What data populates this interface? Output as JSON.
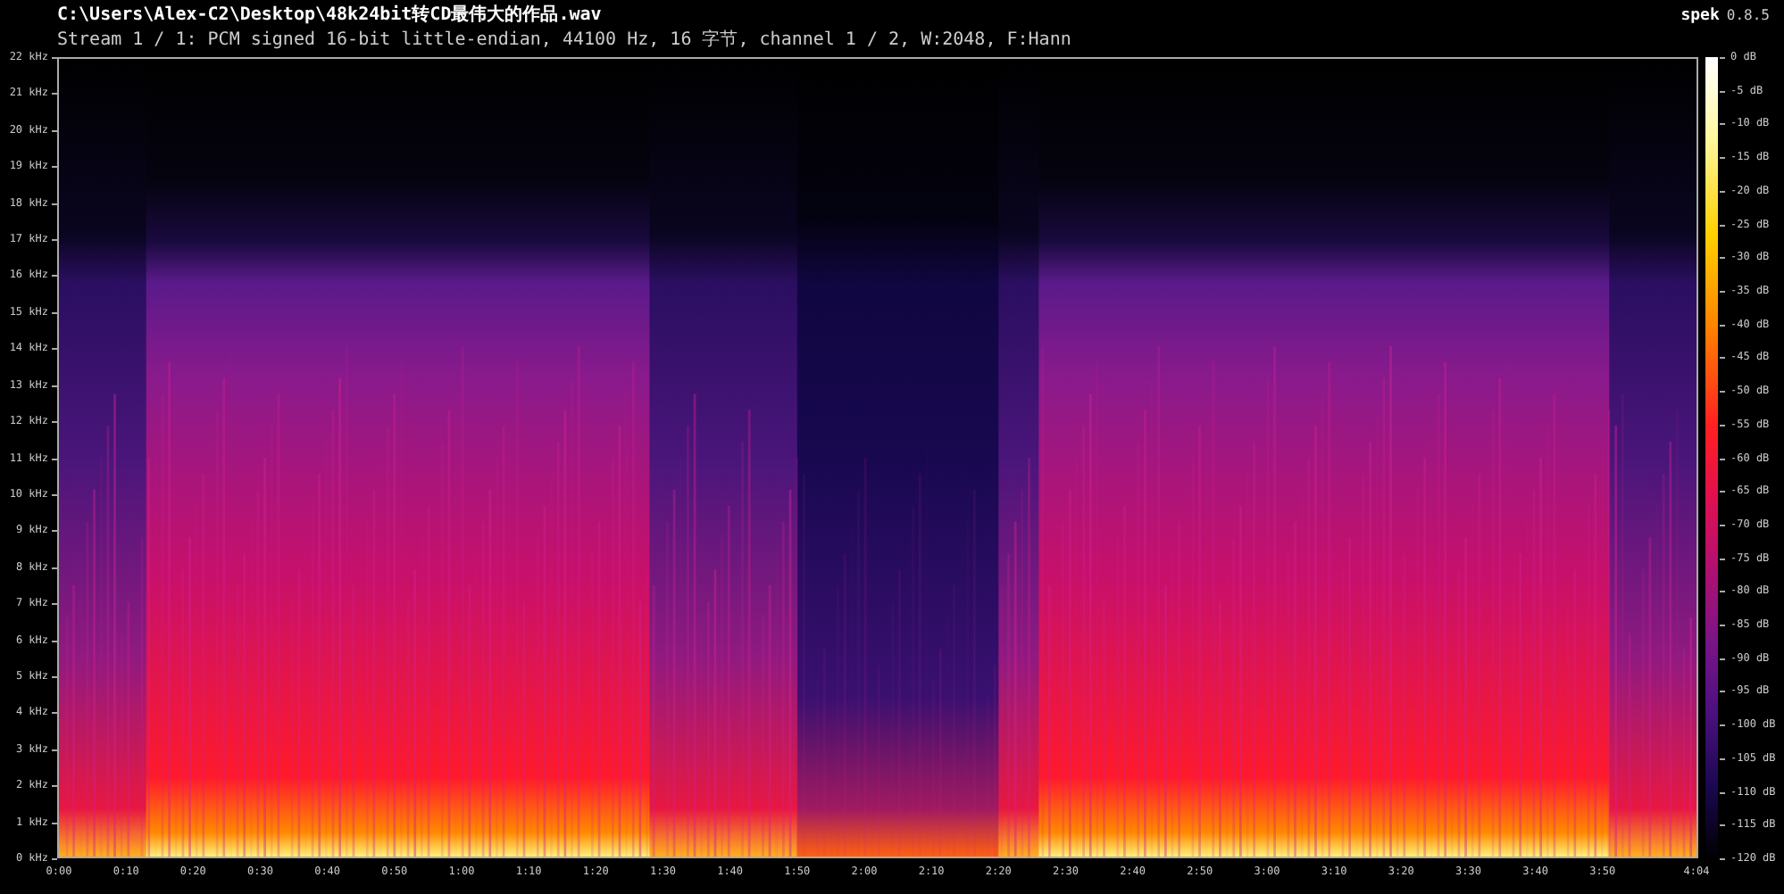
{
  "file_title": "C:\\Users\\Alex-C2\\Desktop\\48k24bit转CD最伟大的作品.wav",
  "stream_info": "Stream 1 / 1: PCM signed 16-bit little-endian, 44100 Hz, 16 字节, channel 1 / 2, W:2048, F:Hann",
  "app_name": "spek",
  "app_version": "0.8.5",
  "frequency_axis": [
    "22 kHz",
    "21 kHz",
    "20 kHz",
    "19 kHz",
    "18 kHz",
    "17 kHz",
    "16 kHz",
    "15 kHz",
    "14 kHz",
    "13 kHz",
    "12 kHz",
    "11 kHz",
    "10 kHz",
    "9 kHz",
    "8 kHz",
    "7 kHz",
    "6 kHz",
    "5 kHz",
    "4 kHz",
    "3 kHz",
    "2 kHz",
    "1 kHz",
    "0 kHz"
  ],
  "time_axis": [
    "0:00",
    "0:10",
    "0:20",
    "0:30",
    "0:40",
    "0:50",
    "1:00",
    "1:10",
    "1:20",
    "1:30",
    "1:40",
    "1:50",
    "2:00",
    "2:10",
    "2:20",
    "2:30",
    "2:40",
    "2:50",
    "3:00",
    "3:10",
    "3:20",
    "3:30",
    "3:40",
    "3:50",
    "4:04"
  ],
  "db_scale": [
    "0 dB",
    "-5 dB",
    "-10 dB",
    "-15 dB",
    "-20 dB",
    "-25 dB",
    "-30 dB",
    "-35 dB",
    "-40 dB",
    "-45 dB",
    "-50 dB",
    "-55 dB",
    "-60 dB",
    "-65 dB",
    "-70 dB",
    "-75 dB",
    "-80 dB",
    "-85 dB",
    "-90 dB",
    "-95 dB",
    "-100 dB",
    "-105 dB",
    "-110 dB",
    "-115 dB",
    "-120 dB"
  ]
}
